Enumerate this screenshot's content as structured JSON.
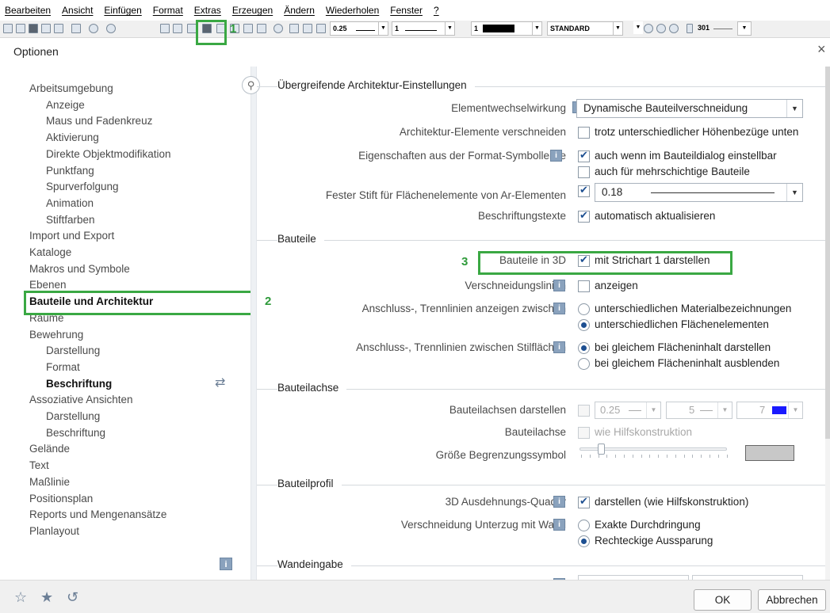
{
  "menu": [
    "Bearbeiten",
    "Ansicht",
    "Einfügen",
    "Format",
    "Extras",
    "Erzeugen",
    "Ändern",
    "Wiederholen",
    "Fenster",
    "?"
  ],
  "toolbar": {
    "pen_value": "0.25",
    "line_value": "1",
    "color_value": "1",
    "layer_value": "STANDARD",
    "pattern_value": "301"
  },
  "dialog": {
    "title": "Optionen",
    "close_symbol": "×"
  },
  "tree": {
    "items": [
      {
        "label": "Arbeitsumgebung",
        "level": 0
      },
      {
        "label": "Anzeige",
        "level": 1
      },
      {
        "label": "Maus und Fadenkreuz",
        "level": 1
      },
      {
        "label": "Aktivierung",
        "level": 1
      },
      {
        "label": "Direkte Objektmodifikation",
        "level": 1
      },
      {
        "label": "Punktfang",
        "level": 1
      },
      {
        "label": "Spurverfolgung",
        "level": 1
      },
      {
        "label": "Animation",
        "level": 1
      },
      {
        "label": "Stiftfarben",
        "level": 1
      },
      {
        "label": "Import und Export",
        "level": 0
      },
      {
        "label": "Kataloge",
        "level": 0
      },
      {
        "label": "Makros und Symbole",
        "level": 0
      },
      {
        "label": "Ebenen",
        "level": 0
      },
      {
        "label": "Bauteile und Architektur",
        "level": 0,
        "bold": true
      },
      {
        "label": "Räume",
        "level": 0
      },
      {
        "label": "Bewehrung",
        "level": 0
      },
      {
        "label": "Darstellung",
        "level": 1
      },
      {
        "label": "Format",
        "level": 1
      },
      {
        "label": "Beschriftung",
        "level": 1,
        "bold": true
      },
      {
        "label": "Assoziative Ansichten",
        "level": 0
      },
      {
        "label": "Darstellung",
        "level": 1
      },
      {
        "label": "Beschriftung",
        "level": 1
      },
      {
        "label": "Gelände",
        "level": 0
      },
      {
        "label": "Text",
        "level": 0
      },
      {
        "label": "Maßlinie",
        "level": 0
      },
      {
        "label": "Positionsplan",
        "level": 0
      },
      {
        "label": "Reports und Mengenansätze",
        "level": 0
      },
      {
        "label": "Planlayout",
        "level": 0
      }
    ]
  },
  "annotations": {
    "one": "1",
    "two": "2",
    "three": "3"
  },
  "sections": {
    "general": "Übergreifende Architektur-Einstellungen",
    "bauteile": "Bauteile",
    "bauteilachse": "Bauteilachse",
    "bauteilprofil": "Bauteilprofil",
    "wandeingabe": "Wandeingabe"
  },
  "general": {
    "elementwechselwirkung_label": "Elementwechselwirkung",
    "elementwechselwirkung_value": "Dynamische Bauteilverschneidung",
    "verschneiden_label": "Architektur-Elemente verschneiden",
    "verschneiden_opt": "trotz unterschiedlicher Höhenbezüge unten",
    "format_label": "Eigenschaften aus der Format-Symbolleiste",
    "format_opt1": "auch wenn im Bauteildialog einstellbar",
    "format_opt2": "auch für mehrschichtige Bauteile",
    "stift_label": "Fester Stift für Flächenelemente von Ar-Elementen",
    "stift_value": "0.18",
    "beschriftung_label": "Beschriftungstexte",
    "beschriftung_opt": "automatisch aktualisieren"
  },
  "bauteile": {
    "bauteile3d_label": "Bauteile in 3D",
    "bauteile3d_opt": "mit Strichart 1 darstellen",
    "verschneidung_label": "Verschneidungslinien",
    "verschneidung_opt": "anzeigen",
    "anschluss_label": "Anschluss-, Trennlinien anzeigen zwischen",
    "anschluss_opt1": "unterschiedlichen Materialbezeichnungen",
    "anschluss_opt2": "unterschiedlichen Flächenelementen",
    "stilflaechen_label": "Anschluss-, Trennlinien zwischen Stilflächen",
    "stilflaechen_opt1": "bei gleichem Flächeninhalt darstellen",
    "stilflaechen_opt2": "bei gleichem Flächeninhalt ausblenden"
  },
  "bauteilachse": {
    "darstellen_label": "Bauteilachsen darstellen",
    "pen_value": "0.25",
    "line_value": "5",
    "color_value": "7",
    "achse_label": "Bauteilachse",
    "achse_opt": "wie Hilfskonstruktion",
    "groesse_label": "Größe Begrenzungssymbol",
    "color_hex": "#1a1aff",
    "swatch_hex": "#c8c8c8"
  },
  "bauteilprofil": {
    "quader_label": "3D Ausdehnungs-Quader",
    "quader_opt": "darstellen (wie Hilfskonstruktion)",
    "unterzug_label": "Verschneidung Unterzug mit Wand",
    "unterzug_opt1": "Exakte Durchdringung",
    "unterzug_opt2": "Rechteckige Aussparung"
  },
  "footer": {
    "ok": "OK",
    "cancel": "Abbrechen"
  },
  "icons": {
    "info": "i"
  }
}
